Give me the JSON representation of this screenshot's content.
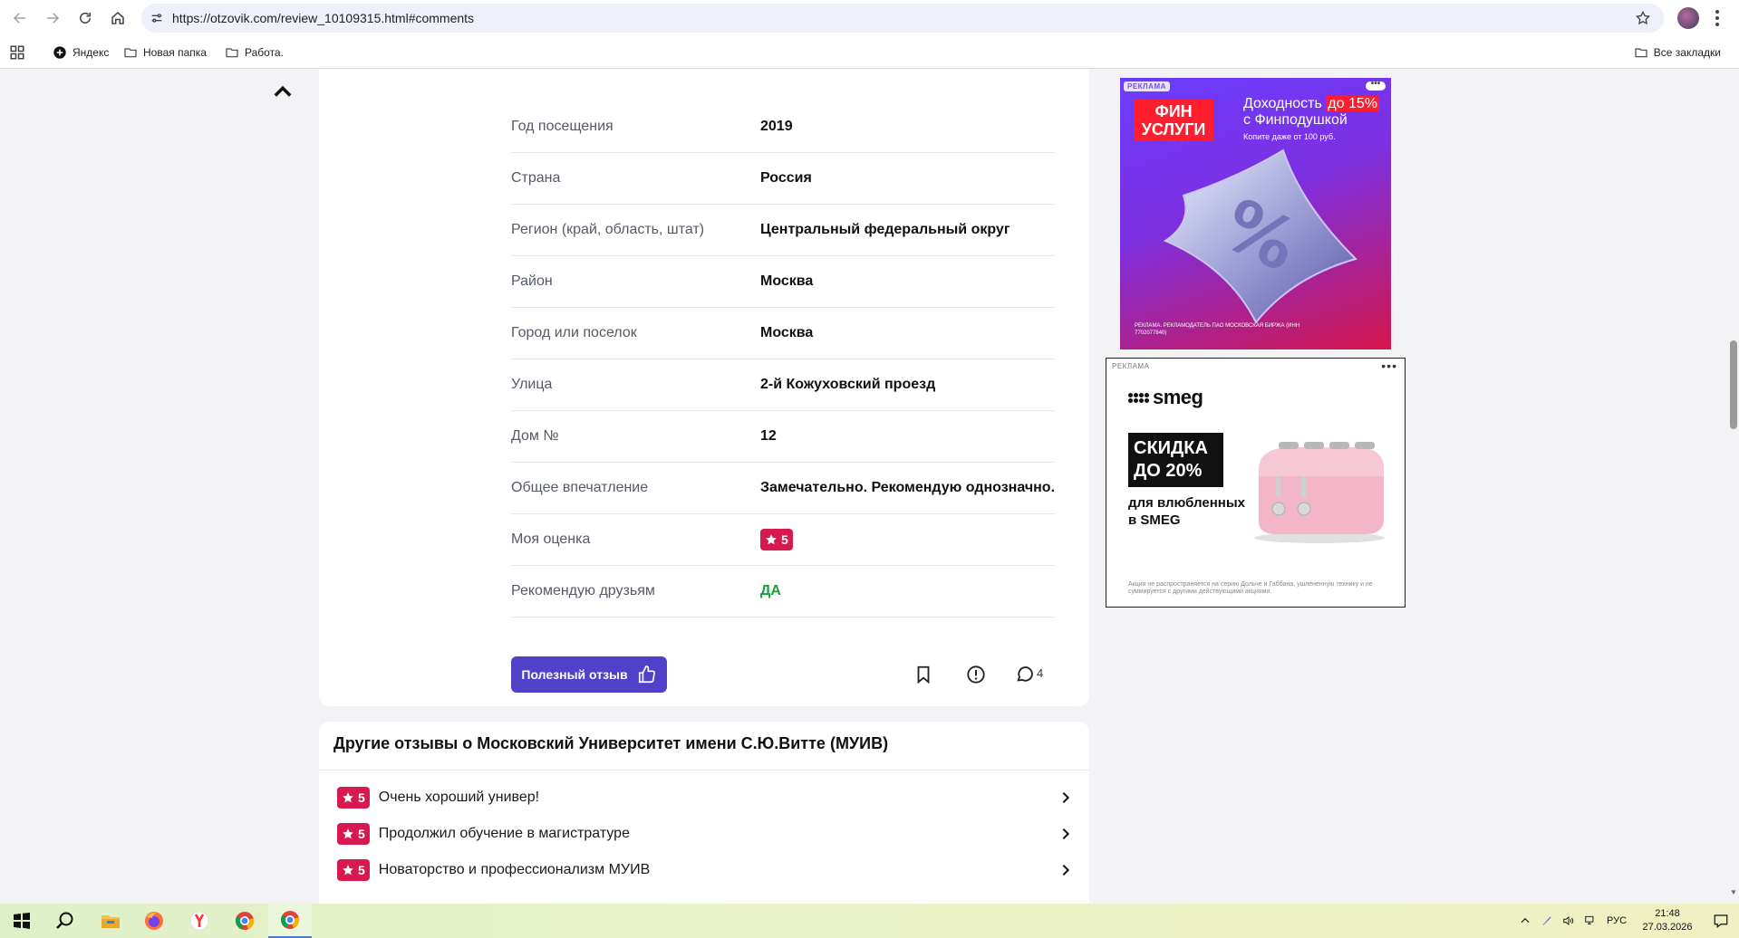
{
  "browser": {
    "url": "https://otzovik.com/review_10109315.html#comments",
    "bookmarks": [
      {
        "label": "Яндекс",
        "icon": "yandex-plus-icon"
      },
      {
        "label": "Новая папка",
        "icon": "folder-icon"
      },
      {
        "label": "Работа.",
        "icon": "folder-icon"
      }
    ],
    "all_bookmarks_label": "Все закладки"
  },
  "review": {
    "properties": [
      {
        "label": "Год посещения",
        "value": "2019"
      },
      {
        "label": "Страна",
        "value": "Россия"
      },
      {
        "label": "Регион (край, область, штат)",
        "value": "Центральный федеральный округ"
      },
      {
        "label": "Район",
        "value": "Москва"
      },
      {
        "label": "Город или поселок",
        "value": "Москва"
      },
      {
        "label": "Улица",
        "value": "2-й Кожуховский проезд"
      },
      {
        "label": "Дом №",
        "value": "12"
      },
      {
        "label": "Общее впечатление",
        "value": "Замечательно. Рекомендую однозначно."
      },
      {
        "label": "Моя оценка",
        "value": "5"
      },
      {
        "label": "Рекомендую друзьям",
        "value": "ДА"
      }
    ],
    "useful_button_label": "Полезный отзыв",
    "comments_count": "4"
  },
  "other_reviews": {
    "title": "Другие отзывы о Московский Университет имени С.Ю.Витте (МУИВ)",
    "items": [
      {
        "rating": "5",
        "title": "Очень хороший универ!"
      },
      {
        "rating": "5",
        "title": "Продолжил обучение в магистратуре"
      },
      {
        "rating": "5",
        "title": "Новаторство и профессионализм МУИВ"
      }
    ]
  },
  "ads": {
    "ad1": {
      "tag": "РЕКЛАМА",
      "logo_line1": "ФИН",
      "logo_line2": "УСЛУГИ",
      "headline_pre": "Доходность",
      "headline_highlight": "до 15%",
      "headline_post": "с Финподушкой",
      "subline": "Копите даже от 100 руб.",
      "legal": "РЕКЛАМА. РЕКЛАМОДАТЕЛЬ ПАО МОСКОВСКАЯ БИРЖА (ИНН 7702077840)",
      "pillow_symbol": "%"
    },
    "ad2": {
      "tag": "РЕКЛАМА",
      "brand": "smeg",
      "sale_line1": "СКИДКА",
      "sale_line2": "ДО 20%",
      "text": "для влюбленных в SMEG",
      "legal": "Акция не распространяется на серию Дольче и Габбана, ушлененную технику и не суммируется с другими действующими акциями."
    }
  },
  "taskbar": {
    "language": "РУС",
    "time": "21:48",
    "date": "27.03.2026"
  },
  "colors": {
    "accent_button": "#5140c8",
    "rating_badge": "#d6194e",
    "recommend_yes": "#19a03c"
  }
}
